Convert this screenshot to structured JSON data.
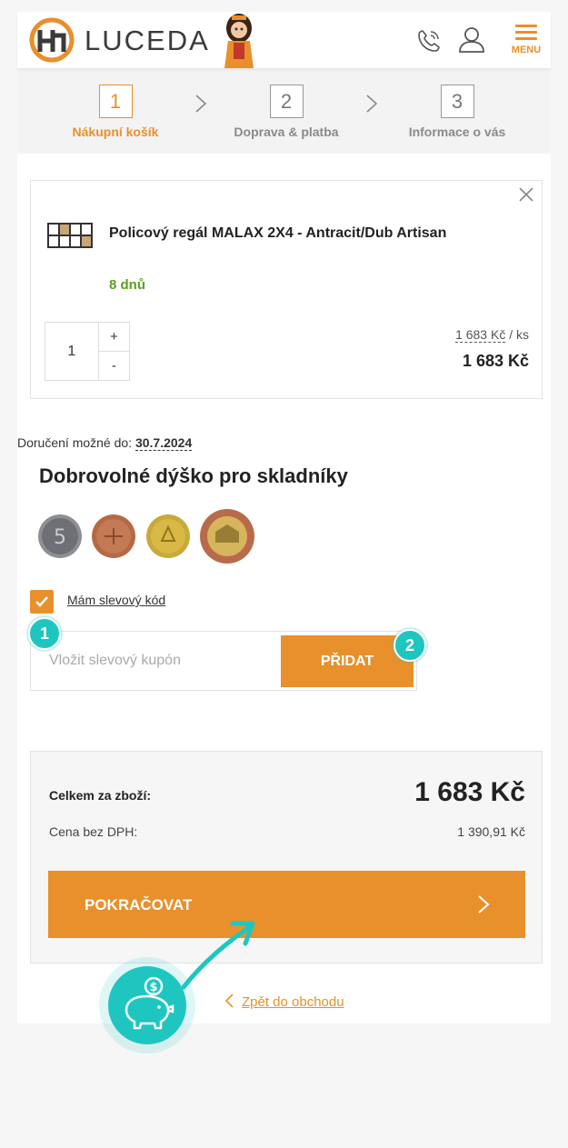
{
  "header": {
    "logo_text": "LUCEDA",
    "menu_label": "MENU"
  },
  "steps": [
    {
      "number": "1",
      "label": "Nákupní košík"
    },
    {
      "number": "2",
      "label": "Doprava & platba"
    },
    {
      "number": "3",
      "label": "Informace o vás"
    }
  ],
  "cart_item": {
    "name": "Policový regál MALAX 2X4 - Antracit/Dub Artisan",
    "availability": "8 dnů",
    "quantity": "1",
    "plus": "+",
    "minus": "-",
    "unit_price": "1 683 Kč",
    "unit_suffix": " / ks",
    "total_price": "1 683 Kč"
  },
  "delivery": {
    "label": "Doručení možné do: ",
    "date": "30.7.2024"
  },
  "tip": {
    "title": "Dobrovolné dýško pro skladníky"
  },
  "discount": {
    "checkbox_label": "Mám slevový kód",
    "checked": true,
    "input_placeholder": "Vložit slevový kupón",
    "button_label": "PŘIDAT",
    "badge_1": "1",
    "badge_2": "2"
  },
  "summary": {
    "total_label": "Celkem za zboží:",
    "total_value": "1 683 Kč",
    "vat_label": "Cena bez DPH:",
    "vat_value": "1 390,91 Kč",
    "continue_label": "POKRAČOVAT"
  },
  "back_link": {
    "label": "Zpět do obchodu"
  },
  "colors": {
    "accent": "#e8902b",
    "availability": "#5ba01b",
    "teal_badge": "#1fc6c0"
  }
}
